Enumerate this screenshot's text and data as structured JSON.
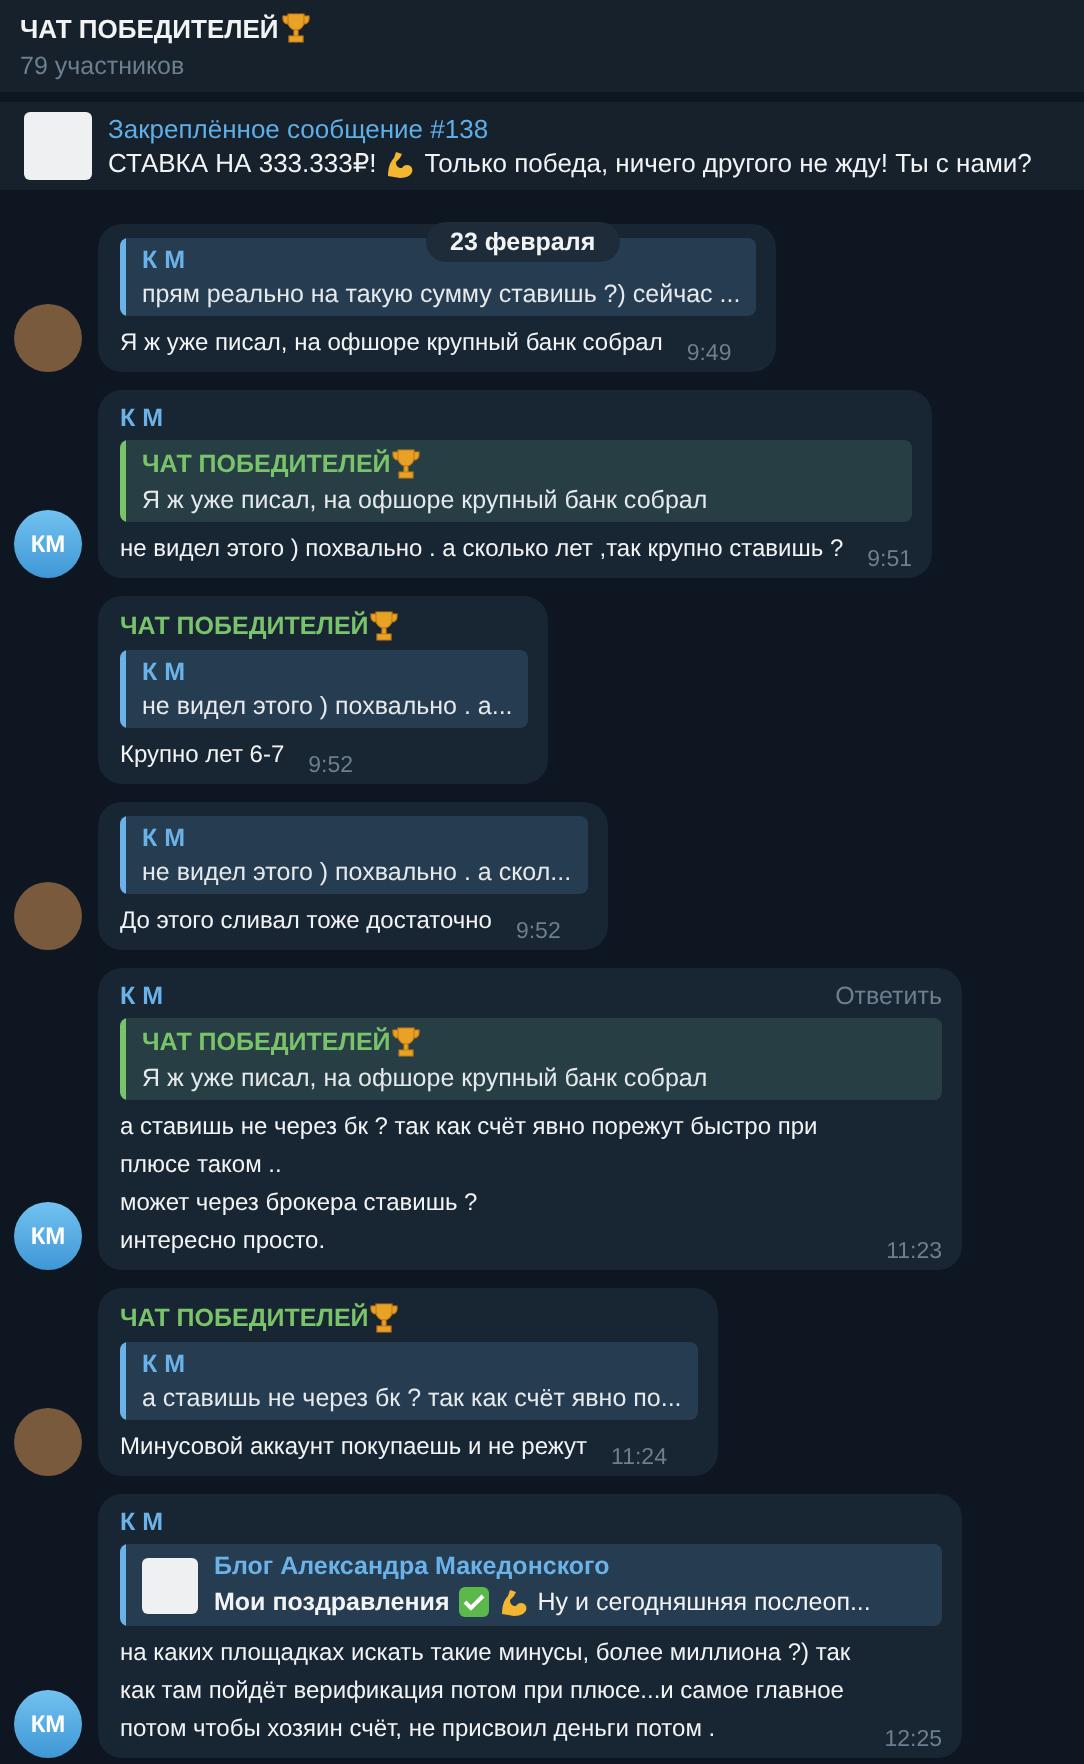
{
  "header": {
    "title": "ЧАТ ПОБЕДИТЕЛЕЙ",
    "trophy": true,
    "subtitle": "79 участников"
  },
  "pinned": {
    "title": "Закреплённое сообщение #138",
    "parts": [
      {
        "kind": "text",
        "text": "СТАВКА НА 333.333₽!"
      },
      {
        "kind": "muscle"
      },
      {
        "kind": "text",
        "text": "Только победа, ничего другого не жду! Ты с нами?"
      }
    ]
  },
  "date_badge": "23 февраля",
  "messages": [
    {
      "avatar": {
        "kind": "photo"
      },
      "reply": {
        "author": "К М",
        "color": "#6ab2e8",
        "text": "прям реально на такую сумму ставишь ?) сейчас ..."
      },
      "text": "Я ж уже писал, на офшоре крупный банк собрал",
      "time": "9:49"
    },
    {
      "sender": {
        "name": "К М",
        "color": "#6ab2e8"
      },
      "reply": {
        "author": "ЧАТ ПОБЕДИТЕЛЕЙ",
        "trophy": true,
        "color": "#79c46a",
        "text": "Я ж уже писал, на офшоре крупный банк собрал"
      },
      "text": "не видел этого ) похвально . а сколько лет ,так крупно ставишь ?",
      "time": "9:51",
      "avatar": {
        "kind": "initials",
        "initials": "КМ"
      }
    },
    {
      "sender": {
        "name": "ЧАТ ПОБЕДИТЕЛЕЙ",
        "trophy": true,
        "color": "#79c46a"
      },
      "reply": {
        "author": "К М",
        "color": "#6ab2e8",
        "text": "не видел этого ) похвально . а..."
      },
      "text": "Крупно лет 6-7",
      "time": "9:52"
    },
    {
      "avatar": {
        "kind": "photo"
      },
      "reply": {
        "author": "К М",
        "color": "#6ab2e8",
        "text": "не видел этого ) похвально . а скол..."
      },
      "text": "До этого сливал тоже достаточно",
      "time": "9:52"
    },
    {
      "sender": {
        "name": "К М",
        "color": "#6ab2e8"
      },
      "action": "Ответить",
      "reply": {
        "author": "ЧАТ ПОБЕДИТЕЛЕЙ",
        "trophy": true,
        "color": "#79c46a",
        "text": "Я ж уже писал, на офшоре крупный банк собрал"
      },
      "text": "а ставишь не через бк ? так как счёт явно порежут быстро при плюсе таком ..\nможет через брокера ставишь ?\nинтересно просто.",
      "time": "11:23",
      "avatar": {
        "kind": "initials",
        "initials": "КМ"
      }
    },
    {
      "sender": {
        "name": "ЧАТ ПОБЕДИТЕЛЕЙ",
        "trophy": true,
        "color": "#79c46a"
      },
      "reply": {
        "author": "К М",
        "color": "#6ab2e8",
        "text": "а ставишь не через бк ? так как счёт явно по..."
      },
      "text": "Минусовой аккаунт покупаешь и не режут",
      "time": "11:24",
      "avatar": {
        "kind": "photo"
      }
    },
    {
      "sender": {
        "name": "К М",
        "color": "#6ab2e8"
      },
      "reply": {
        "author": "Блог Александра Македонского",
        "color": "#6ab2e8",
        "thumbnail": true,
        "parts": [
          {
            "kind": "bold",
            "text": "Мои поздравления"
          },
          {
            "kind": "check"
          },
          {
            "kind": "muscle"
          },
          {
            "kind": "text",
            "text": "Ну и сегодняшняя послеоп..."
          }
        ]
      },
      "text": "на каких площадках искать такие минусы, более миллиона ?) так как там пойдёт верификация потом при плюсе...и самое главное потом чтобы хозяин счёт, не присвоил деньги потом .",
      "time": "12:25",
      "avatar": {
        "kind": "initials",
        "initials": "КМ"
      }
    }
  ]
}
